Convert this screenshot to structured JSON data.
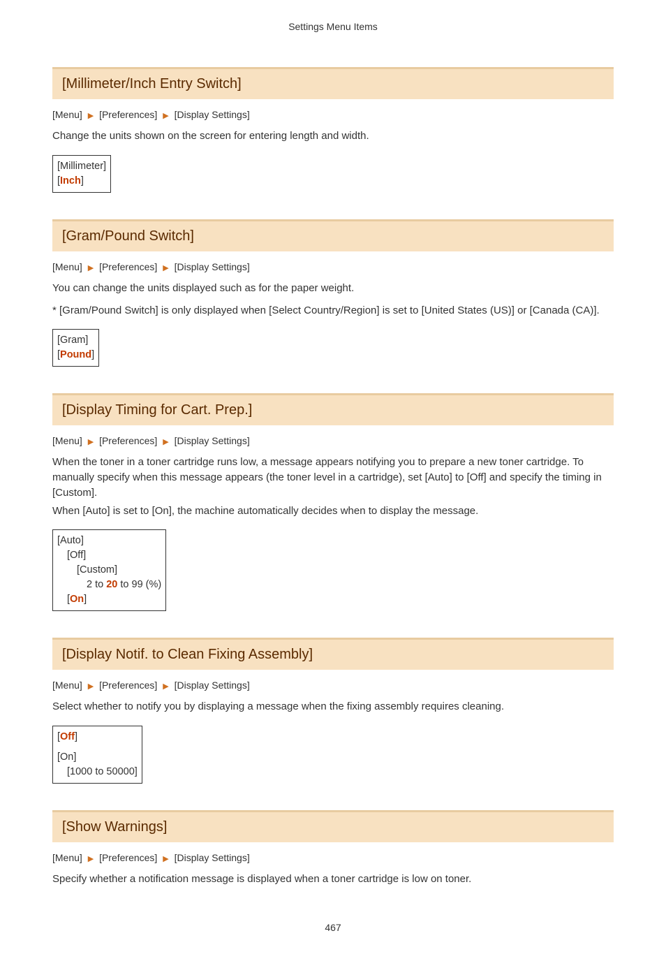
{
  "header": {
    "title": "Settings Menu Items"
  },
  "breadcrumb_labels": {
    "menu": "[Menu]",
    "preferences": "[Preferences]",
    "display_settings": "[Display Settings]"
  },
  "sections": {
    "mm_inch": {
      "heading": "[Millimeter/Inch Entry Switch]",
      "desc": "Change the units shown on the screen for entering length and width.",
      "opt_millimeter": "[Millimeter]",
      "opt_inch_default": "Inch"
    },
    "gram_pound": {
      "heading": "[Gram/Pound Switch]",
      "desc": "You can change the units displayed such as for the paper weight.",
      "note": "* [Gram/Pound Switch] is only displayed when [Select Country/Region] is set to [United States (US)] or [Canada (CA)].",
      "opt_gram": "[Gram]",
      "opt_pound_default": "Pound"
    },
    "cart_prep": {
      "heading": "[Display Timing for Cart. Prep.]",
      "desc1": "When the toner in a toner cartridge runs low, a message appears notifying you to prepare a new toner cartridge. To manually specify when this message appears (the toner level in a cartridge), set [Auto] to [Off] and specify the timing in [Custom].",
      "desc2": "When [Auto] is set to [On], the machine automatically decides when to display the message.",
      "opt_auto": "[Auto]",
      "opt_off": "[Off]",
      "opt_custom": "[Custom]",
      "range_pre": "2 to ",
      "range_default": "20",
      "range_post": " to 99 (%)",
      "opt_on_default": "On"
    },
    "clean_fixing": {
      "heading": "[Display Notif. to Clean Fixing Assembly]",
      "desc": "Select whether to notify you by displaying a message when the fixing assembly requires cleaning.",
      "opt_off_default": "Off",
      "opt_on": "[On]",
      "opt_range": "[1000 to 50000]"
    },
    "show_warnings": {
      "heading": "[Show Warnings]",
      "desc": "Specify whether a notification message is displayed when a toner cartridge is low on toner."
    }
  },
  "page_number": "467"
}
